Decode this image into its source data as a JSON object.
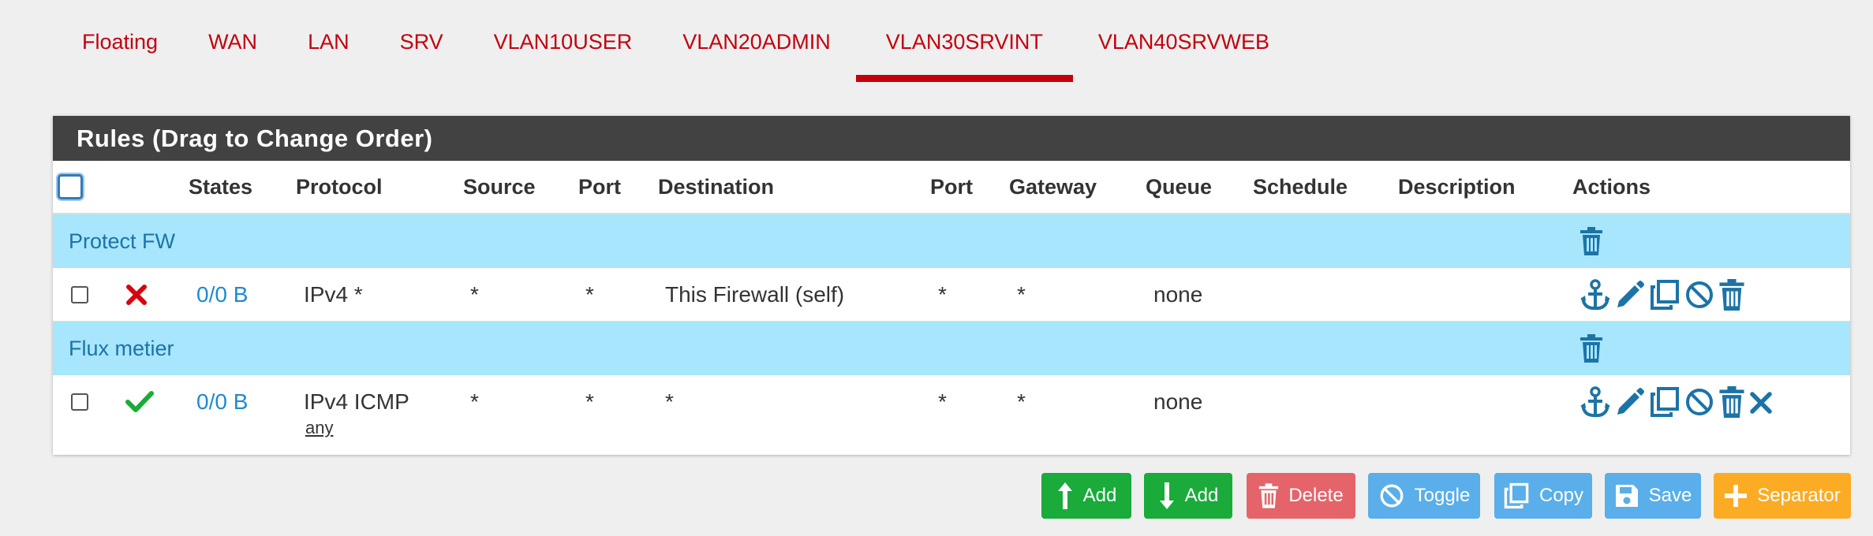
{
  "tabs": {
    "items": [
      "Floating",
      "WAN",
      "LAN",
      "SRV",
      "VLAN10USER",
      "VLAN20ADMIN",
      "VLAN30SRVINT",
      "VLAN40SRVWEB"
    ],
    "active": "VLAN30SRVINT"
  },
  "panel": {
    "title": "Rules (Drag to Change Order)"
  },
  "columns": {
    "states": "States",
    "protocol": "Protocol",
    "source": "Source",
    "port": "Port",
    "destination": "Destination",
    "dport": "Port",
    "gateway": "Gateway",
    "queue": "Queue",
    "schedule": "Schedule",
    "description": "Description",
    "actions": "Actions"
  },
  "separators": [
    {
      "label": "Protect FW"
    },
    {
      "label": "Flux metier"
    }
  ],
  "rules": [
    {
      "status": "blocked",
      "states": "0/0 B",
      "protocol": "IPv4 *",
      "protocol_sub": "",
      "source": "*",
      "port": "*",
      "destination": "This Firewall (self)",
      "dport": "*",
      "gateway": "*",
      "queue": "none",
      "schedule": "",
      "description": ""
    },
    {
      "status": "pass",
      "states": "0/0 B",
      "protocol": "IPv4 ICMP",
      "protocol_sub": "any",
      "source": "*",
      "port": "*",
      "destination": "*",
      "dport": "*",
      "gateway": "*",
      "queue": "none",
      "schedule": "",
      "description": ""
    }
  ],
  "buttons": {
    "add_top": "Add",
    "add_bottom": "Add",
    "delete": "Delete",
    "toggle": "Toggle",
    "copy": "Copy",
    "save": "Save",
    "separator": "Separator"
  },
  "colors": {
    "accent_red": "#c3000e",
    "separator_bg": "#a7e6fd",
    "icon_blue": "#1c73a6",
    "pass_green": "#1aab3a",
    "block_red": "#d9000f"
  }
}
